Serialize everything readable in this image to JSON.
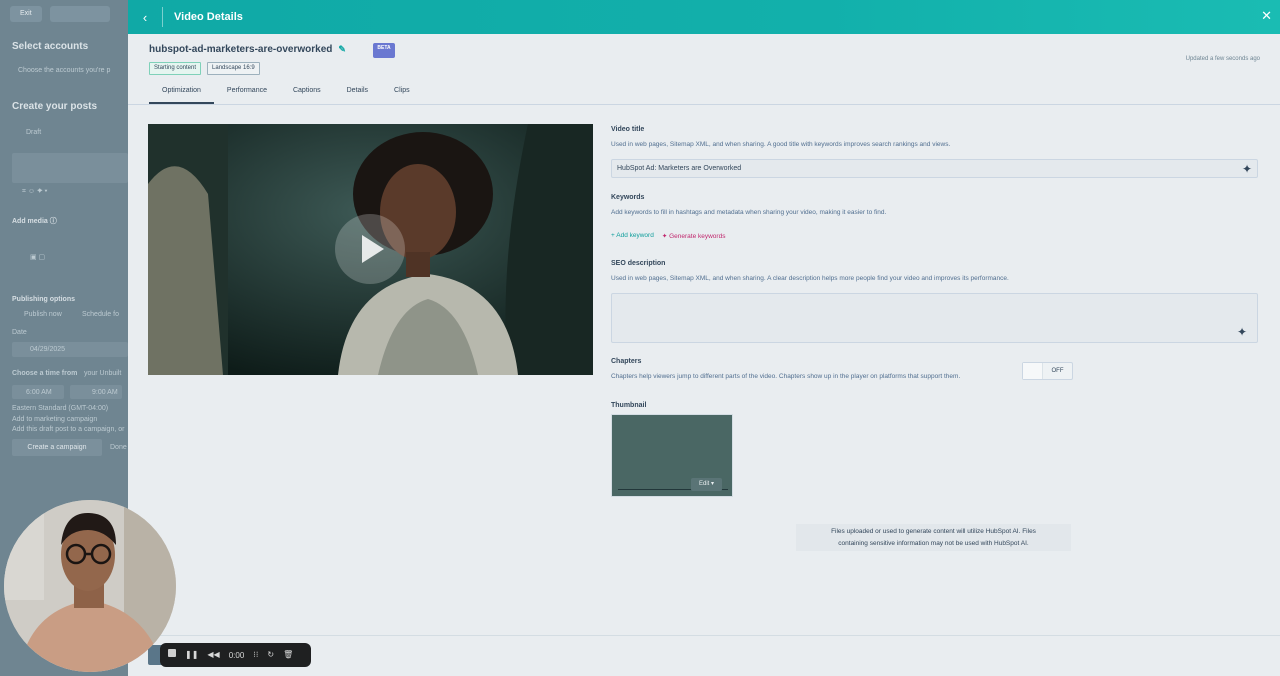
{
  "background_app": {
    "exit_label": "Exit",
    "select_accounts": "Select accounts",
    "choose_accounts": "Choose the accounts you're p",
    "create_posts": "Create your posts",
    "draft": "Draft",
    "add_media": "Add media ⓘ",
    "publishing_options": "Publishing options",
    "publish_now": "Publish now",
    "schedule": "Schedule fo",
    "date_label": "Date",
    "date_value": "04/29/2025",
    "choose_time": "Choose a time from",
    "your_unbuilt": "your Unbuilt",
    "time_slot_1": "6:00 AM",
    "time_slot_2": "9:00 AM",
    "timezone": "Eastern Standard (GMT-04:00)",
    "add_marketing": "Add to marketing campaign",
    "add_marketing_sub": "Add this draft post to a campaign, or",
    "create_campaign": "Create a campaign",
    "done": "Done"
  },
  "header": {
    "title": "Video Details"
  },
  "video": {
    "name": "hubspot-ad-marketers-are-overworked",
    "beta_badge": "BETA",
    "tags": [
      "Starting content",
      "Landscape 16:9"
    ],
    "updated": "Updated a few seconds ago"
  },
  "tabs": [
    "Optimization",
    "Performance",
    "Captions",
    "Details",
    "Clips"
  ],
  "form": {
    "video_title_label": "Video title",
    "video_title_help": "Used in web pages, Sitemap XML, and when sharing. A good title with keywords improves search rankings and views.",
    "video_title_value": "HubSpot Ad: Marketers are Overworked",
    "keywords_label": "Keywords",
    "keywords_help": "Add keywords to fill in hashtags and metadata when sharing your video, making it easier to find.",
    "add_keyword": "+ Add keyword",
    "generate_keywords": "✦ Generate keywords",
    "seo_label": "SEO description",
    "seo_help": "Used in web pages, Sitemap XML, and when sharing. A clear description helps more people find your video and improves its performance.",
    "seo_value": "",
    "chapters_label": "Chapters",
    "chapters_help": "Chapters help viewers jump to different parts of the video. Chapters show up in the player on platforms that support them.",
    "chapters_toggle": "OFF",
    "thumbnail_label": "Thumbnail",
    "thumbnail_edit": "Edit ▾",
    "ai_note_line1": "Files uploaded or used to generate content will utilize HubSpot AI. Files",
    "ai_note_line2": "containing sensitive information may not be used with HubSpot AI."
  },
  "recorder": {
    "time": "0:00"
  },
  "icons": {
    "back": "chevron-left-icon",
    "close": "close-icon",
    "edit": "pencil-icon",
    "ai": "sparkle-icon",
    "play": "play-icon"
  },
  "colors": {
    "header_teal": "#12b0ab",
    "link_teal": "#0f9e9b",
    "ai_magenta": "#c0276d",
    "beta_purple": "#6a78d1"
  }
}
